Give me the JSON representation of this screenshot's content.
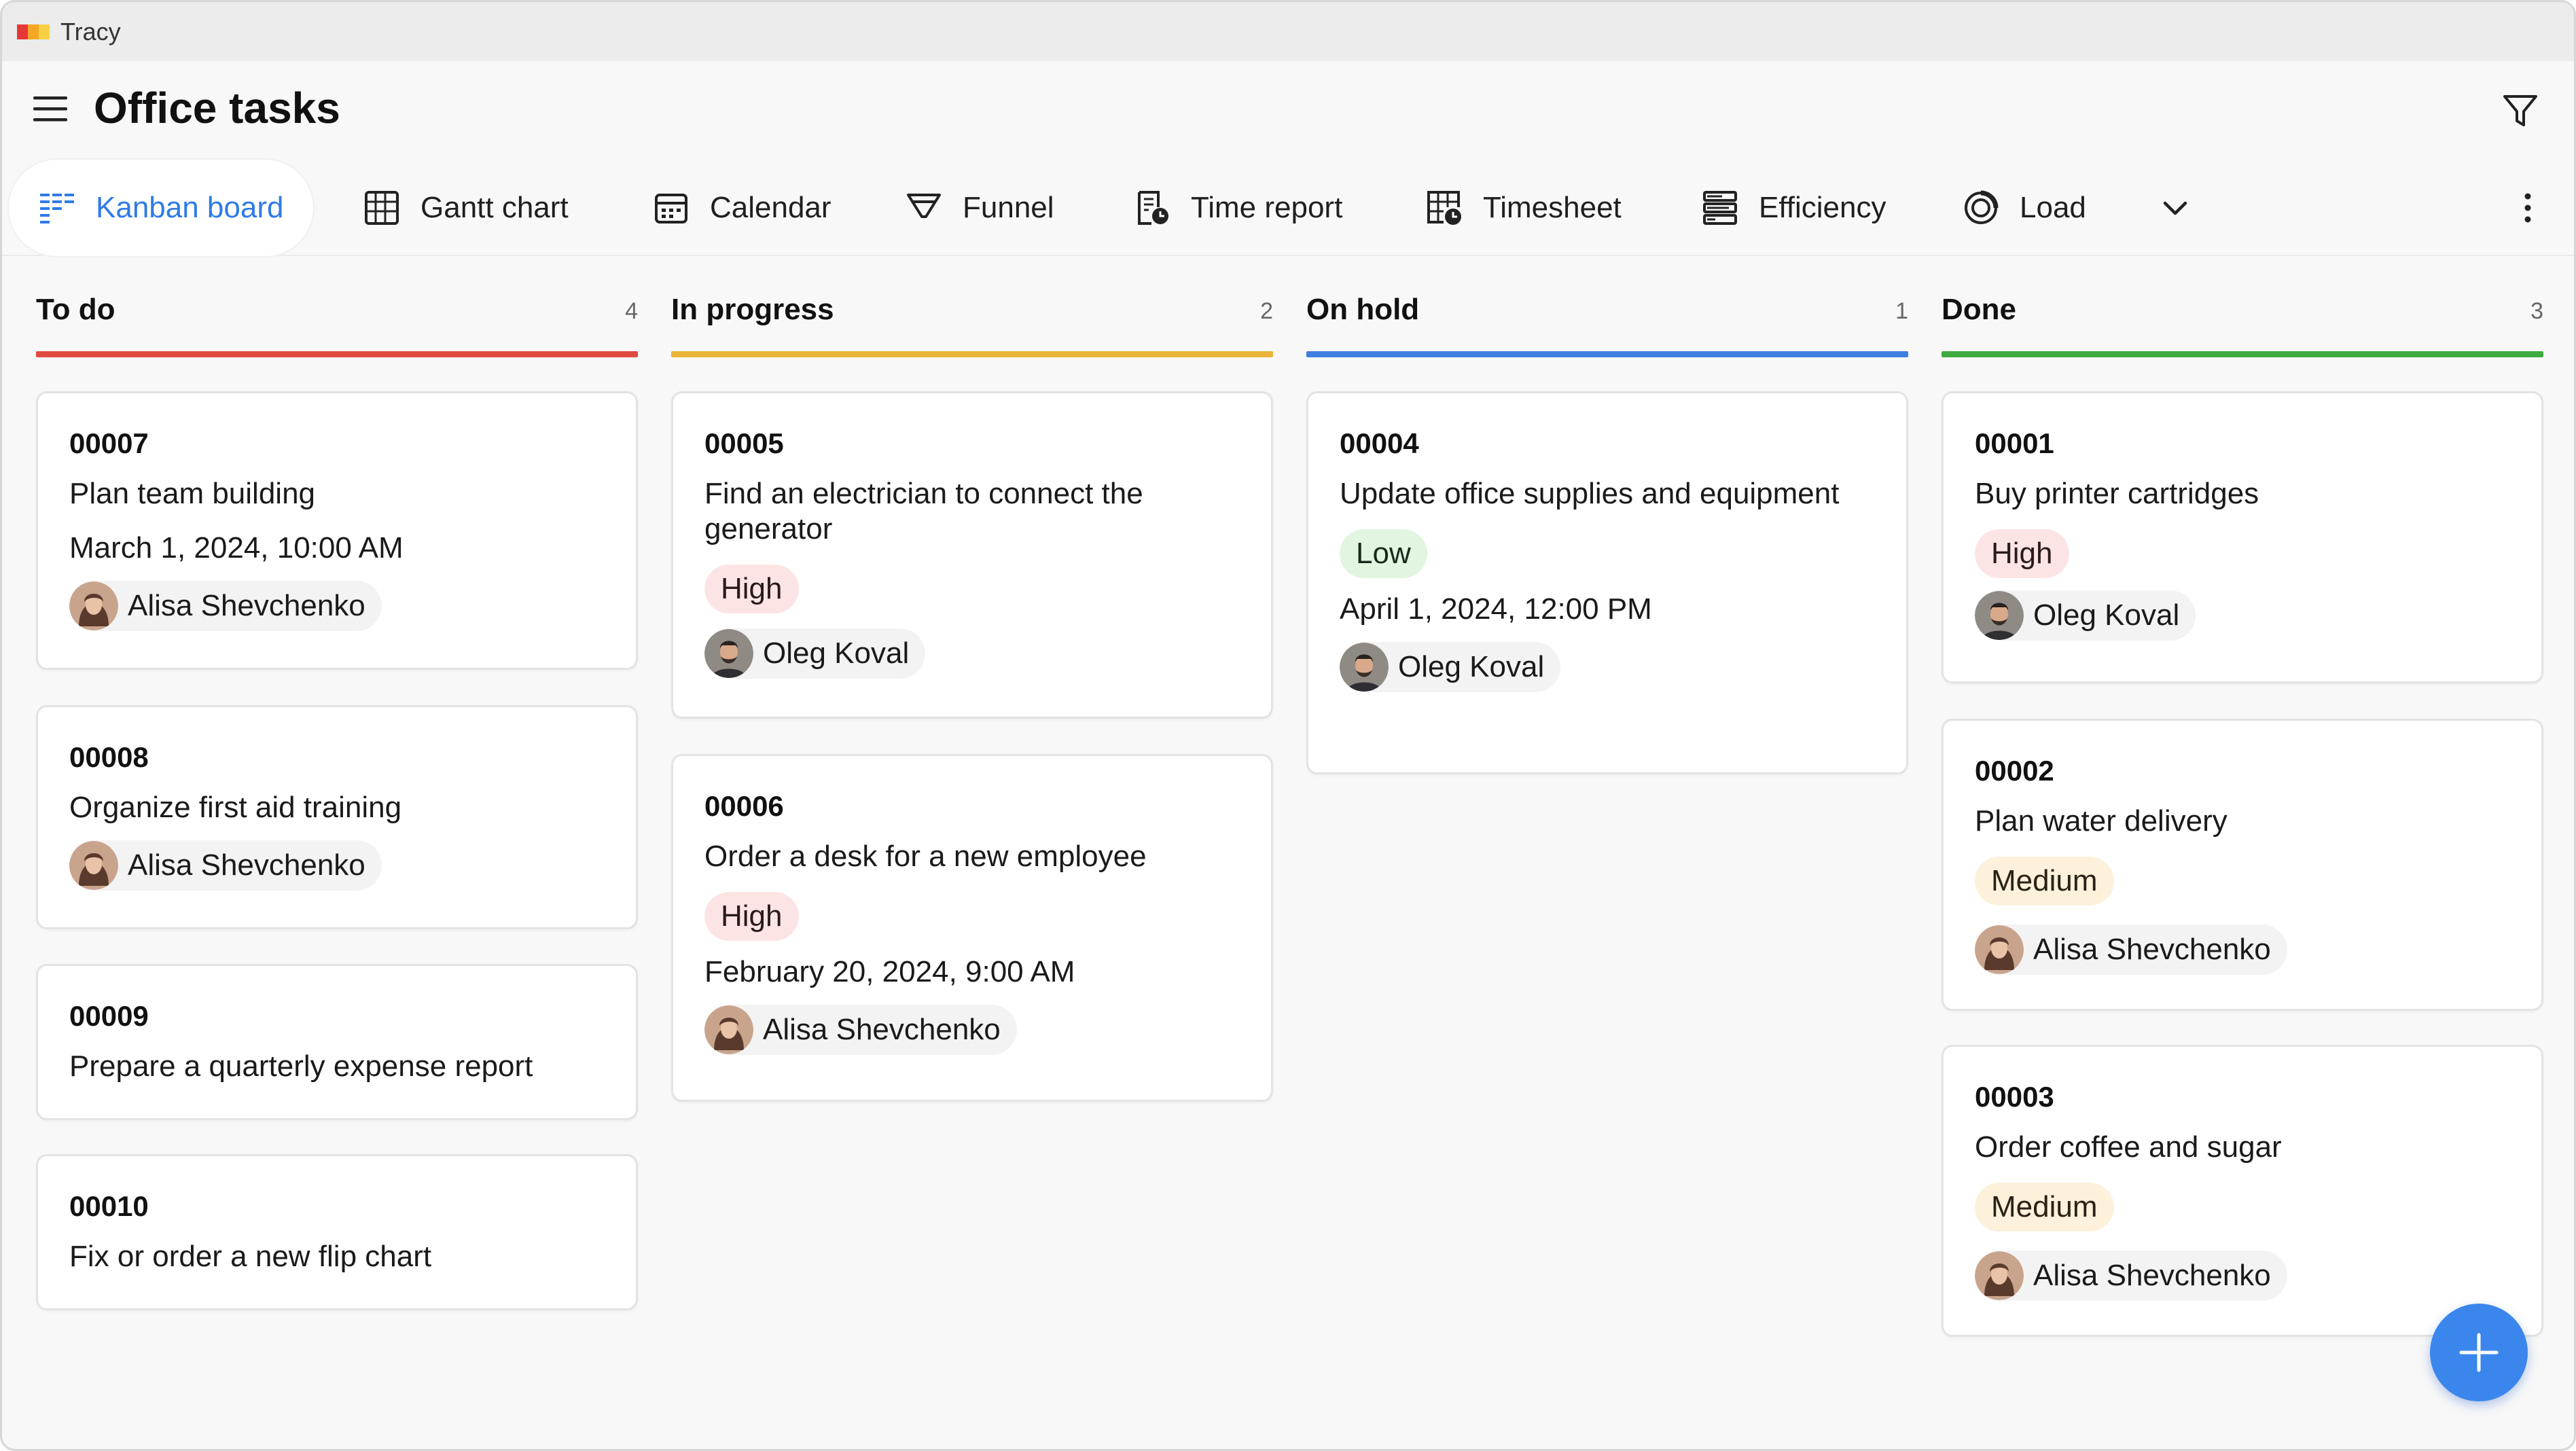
{
  "app": {
    "title": "Tracy",
    "logo_colors": [
      "#e53935",
      "#f5a623",
      "#f7d046"
    ]
  },
  "header": {
    "title": "Office tasks"
  },
  "tabs": [
    {
      "label": "Kanban board",
      "icon": "kanban-icon",
      "active": true
    },
    {
      "label": "Gantt chart",
      "icon": "gantt-icon"
    },
    {
      "label": "Calendar",
      "icon": "calendar-icon"
    },
    {
      "label": "Funnel",
      "icon": "funnel-icon"
    },
    {
      "label": "Time report",
      "icon": "time-report-icon"
    },
    {
      "label": "Timesheet",
      "icon": "timesheet-icon"
    },
    {
      "label": "Efficiency",
      "icon": "efficiency-icon"
    },
    {
      "label": "Load",
      "icon": "load-icon"
    }
  ],
  "colors": {
    "accent": "#2f7be6",
    "todo": "#e04a3f",
    "in_progress": "#e9b437",
    "on_hold": "#3f7fe0",
    "done": "#3faa3f",
    "fab": "#3b86ec"
  },
  "columns": [
    {
      "title": "To do",
      "count": "4",
      "cards": [
        {
          "id": "00007",
          "title": "Plan team building",
          "date": "March 1, 2024, 10:00 AM",
          "assignee": "Alisa Shevchenko"
        },
        {
          "id": "00008",
          "title": "Organize first aid training",
          "assignee": "Alisa Shevchenko"
        },
        {
          "id": "00009",
          "title": "Prepare a quarterly expense report"
        },
        {
          "id": "00010",
          "title": "Fix or order a new flip chart"
        }
      ]
    },
    {
      "title": "In progress",
      "count": "2",
      "cards": [
        {
          "id": "00005",
          "title": "Find an electrician to connect the generator",
          "priority": "High",
          "assignee": "Oleg Koval"
        },
        {
          "id": "00006",
          "title": "Order a desk for a new employee",
          "priority": "High",
          "date": "February 20, 2024, 9:00 AM",
          "assignee": "Alisa Shevchenko"
        }
      ]
    },
    {
      "title": "On hold",
      "count": "1",
      "cards": [
        {
          "id": "00004",
          "title": "Update office supplies and equipment",
          "priority": "Low",
          "date": "April 1, 2024, 12:00 PM",
          "assignee": "Oleg Koval"
        }
      ]
    },
    {
      "title": "Done",
      "count": "3",
      "cards": [
        {
          "id": "00001",
          "title": "Buy printer cartridges",
          "priority": "High",
          "assignee": "Oleg Koval"
        },
        {
          "id": "00002",
          "title": "Plan water delivery",
          "priority": "Medium",
          "assignee": "Alisa Shevchenko"
        },
        {
          "id": "00003",
          "title": "Order coffee and sugar",
          "priority": "Medium",
          "assignee": "Alisa Shevchenko"
        }
      ]
    }
  ]
}
